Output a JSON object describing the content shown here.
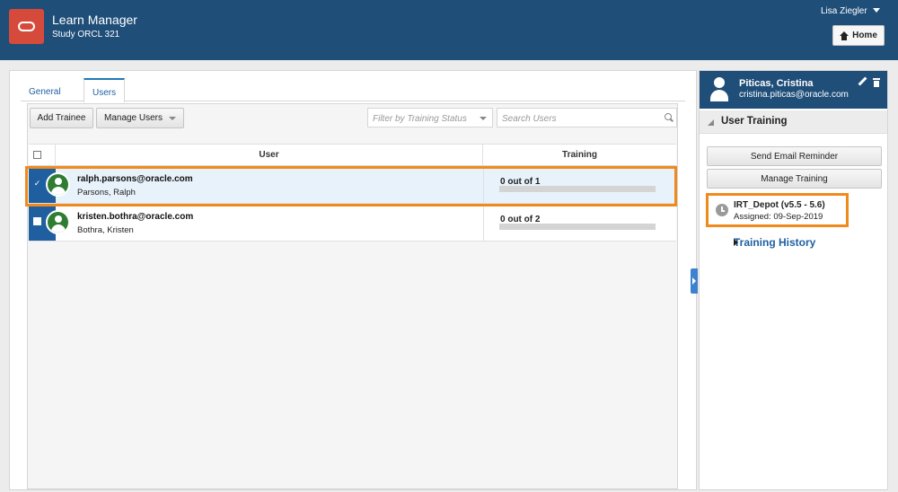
{
  "header": {
    "app_title": "Learn Manager",
    "study": "Study ORCL 321",
    "user_name": "Lisa Ziegler",
    "home_label": "Home"
  },
  "tabs": [
    {
      "label": "General",
      "active": false
    },
    {
      "label": "Users",
      "active": true
    }
  ],
  "toolbar": {
    "add_trainee_label": "Add Trainee",
    "manage_users_label": "Manage Users",
    "filter_placeholder": "Filter by Training Status",
    "search_placeholder": "Search Users"
  },
  "table": {
    "columns": [
      "User",
      "Training"
    ],
    "rows": [
      {
        "email": "ralph.parsons@oracle.com",
        "name": "Parsons, Ralph",
        "training": "0 out of 1",
        "progress": 0,
        "selected": true
      },
      {
        "email": "kristen.bothra@oracle.com",
        "name": "Bothra, Kristen",
        "training": "0 out of 2",
        "progress": 0,
        "selected": false
      }
    ]
  },
  "profile": {
    "name": "Piticas, Cristina",
    "email": "cristina.piticas@oracle.com"
  },
  "user_training": {
    "section_title": "User Training",
    "send_email_label": "Send Email Reminder",
    "manage_training_label": "Manage Training",
    "course": {
      "name": "IRT_Depot (v5.5 - 5.6)",
      "assigned": "Assigned: 09-Sep-2019"
    },
    "history_label": "Training History"
  },
  "colors": {
    "header_bg": "#1f4e79",
    "accent": "#1f5f9f",
    "highlight": "#f08a1c",
    "logo": "#d64a3c",
    "avatar": "#2e7d32"
  }
}
